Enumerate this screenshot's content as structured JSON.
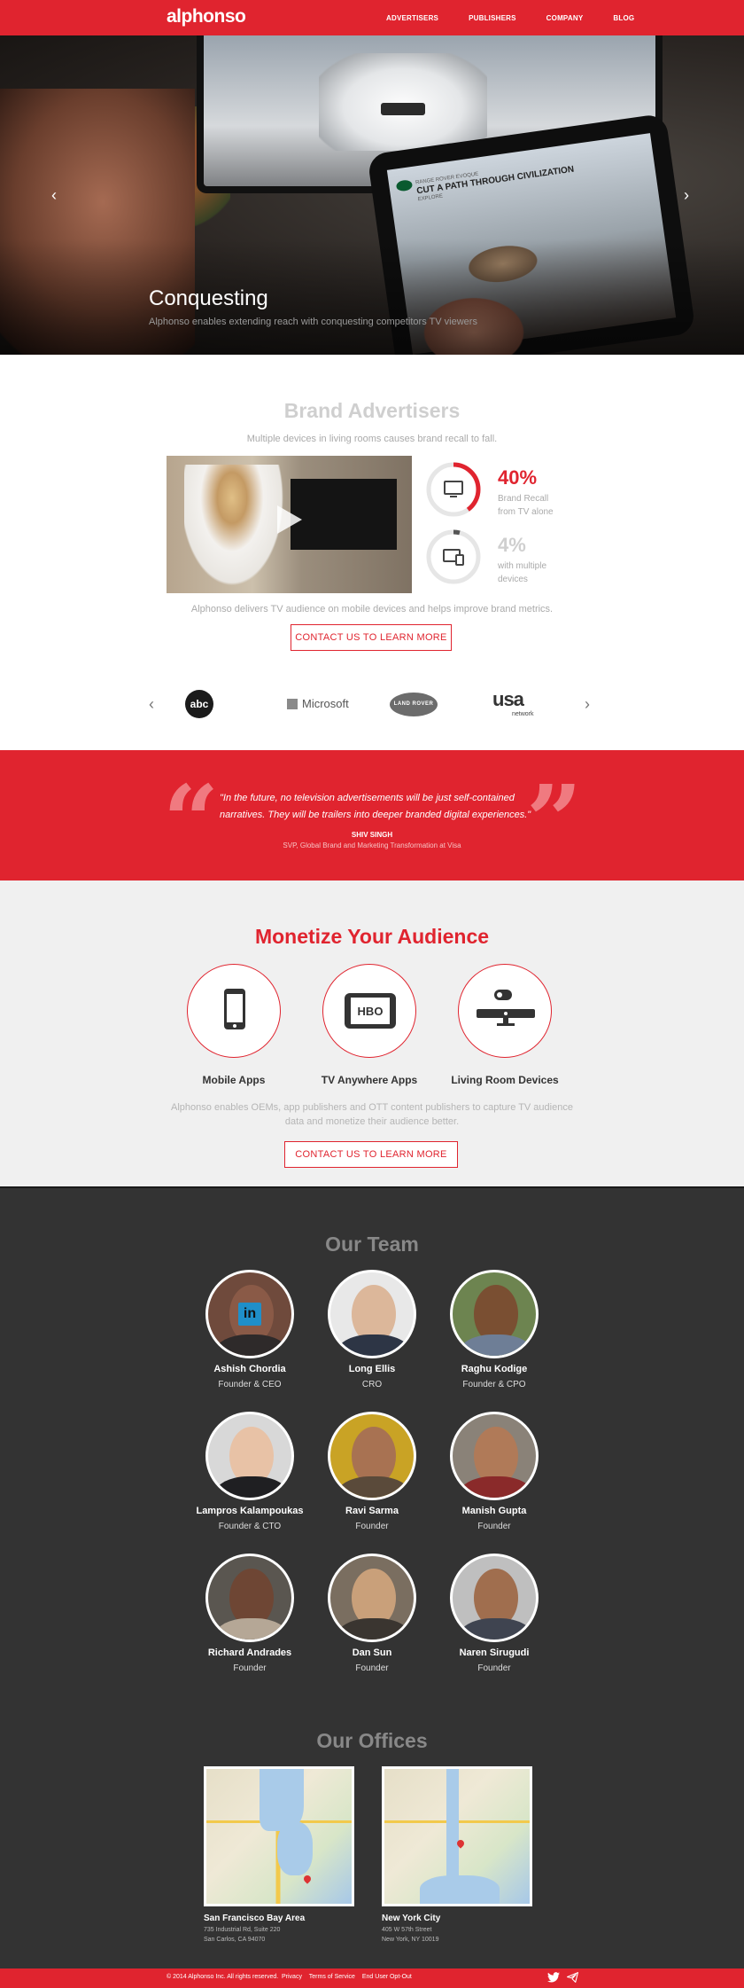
{
  "nav": {
    "logo": "alphonso",
    "items": [
      "ADVERTISERS",
      "PUBLISHERS",
      "COMPANY",
      "BLOG"
    ]
  },
  "hero": {
    "title": "Conquesting",
    "subtitle": "Alphonso enables extending reach with conquesting competitors TV viewers",
    "tablet_brand": "RANGE ROVER EVOQUE",
    "tablet_headline": "CUT A PATH THROUGH CIVILIZATION",
    "tablet_cta": "EXPLORE",
    "prev_arrow": "‹",
    "next_arrow": "›"
  },
  "brand": {
    "title": "Brand Advertisers",
    "subtitle": "Multiple devices in living rooms causes brand recall to fall.",
    "stats": [
      {
        "value": "40%",
        "label": "Brand Recall from TV alone",
        "percent": 40,
        "icon": "tv-icon"
      },
      {
        "value": "4%",
        "label": "with multiple devices",
        "percent": 4,
        "icon": "devices-icon"
      }
    ],
    "description": "Alphonso delivers TV audience on mobile devices and helps improve brand metrics.",
    "cta": "CONTACT US TO LEARN MORE",
    "logos": [
      "abc",
      "Microsoft",
      "LAND ROVER",
      "usa",
      "network"
    ],
    "carousel_prev": "‹",
    "carousel_next": "›"
  },
  "quote": {
    "text": "\"In the future, no television advertisements will be just self-contained narratives. They will be trailers into deeper branded digital experiences.\"",
    "author": "SHIV SINGH",
    "role": "SVP, Global Brand and Marketing Transformation at Visa",
    "open_mark": "“",
    "close_mark": "”"
  },
  "monetize": {
    "title": "Monetize Your Audience",
    "items": [
      {
        "label": "Mobile Apps",
        "icon": "smartphone-icon"
      },
      {
        "label": "TV Anywhere Apps",
        "icon": "tablet-hbo-icon"
      },
      {
        "label": "Living Room Devices",
        "icon": "set-top-box-icon"
      }
    ],
    "hbo_text": "HBO",
    "description": "Alphonso enables OEMs, app publishers and OTT content publishers to capture TV audience data and monetize their audience better.",
    "cta": "CONTACT US TO LEARN MORE"
  },
  "team": {
    "title": "Our Team",
    "linkedin_text": "in",
    "members": [
      {
        "name": "Ashish Chordia",
        "role": "Founder & CEO"
      },
      {
        "name": "Long Ellis",
        "role": "CRO"
      },
      {
        "name": "Raghu Kodige",
        "role": "Founder & CPO"
      },
      {
        "name": "Lampros Kalampoukas",
        "role": "Founder & CTO"
      },
      {
        "name": "Ravi Sarma",
        "role": "Founder"
      },
      {
        "name": "Manish Gupta",
        "role": "Founder"
      },
      {
        "name": "Richard Andrades",
        "role": "Founder"
      },
      {
        "name": "Dan Sun",
        "role": "Founder"
      },
      {
        "name": "Naren Sirugudi",
        "role": "Founder"
      }
    ]
  },
  "offices": {
    "title": "Our Offices",
    "locations": [
      {
        "city": "San Francisco Bay Area",
        "address1": "735 Industrial Rd, Suite 220",
        "address2": "San Carlos, CA 94070"
      },
      {
        "city": "New York City",
        "address1": "405 W 57th Street",
        "address2": "New York, NY 10019"
      }
    ]
  },
  "footer": {
    "copyright": "© 2014 Alphonso Inc. All rights reserved.",
    "links": [
      "Privacy",
      "Terms of Service",
      "End User Opt-Out"
    ]
  },
  "colors": {
    "brand_red": "#e0242f",
    "dark": "#333333",
    "light_bg": "#f0f0f0"
  }
}
